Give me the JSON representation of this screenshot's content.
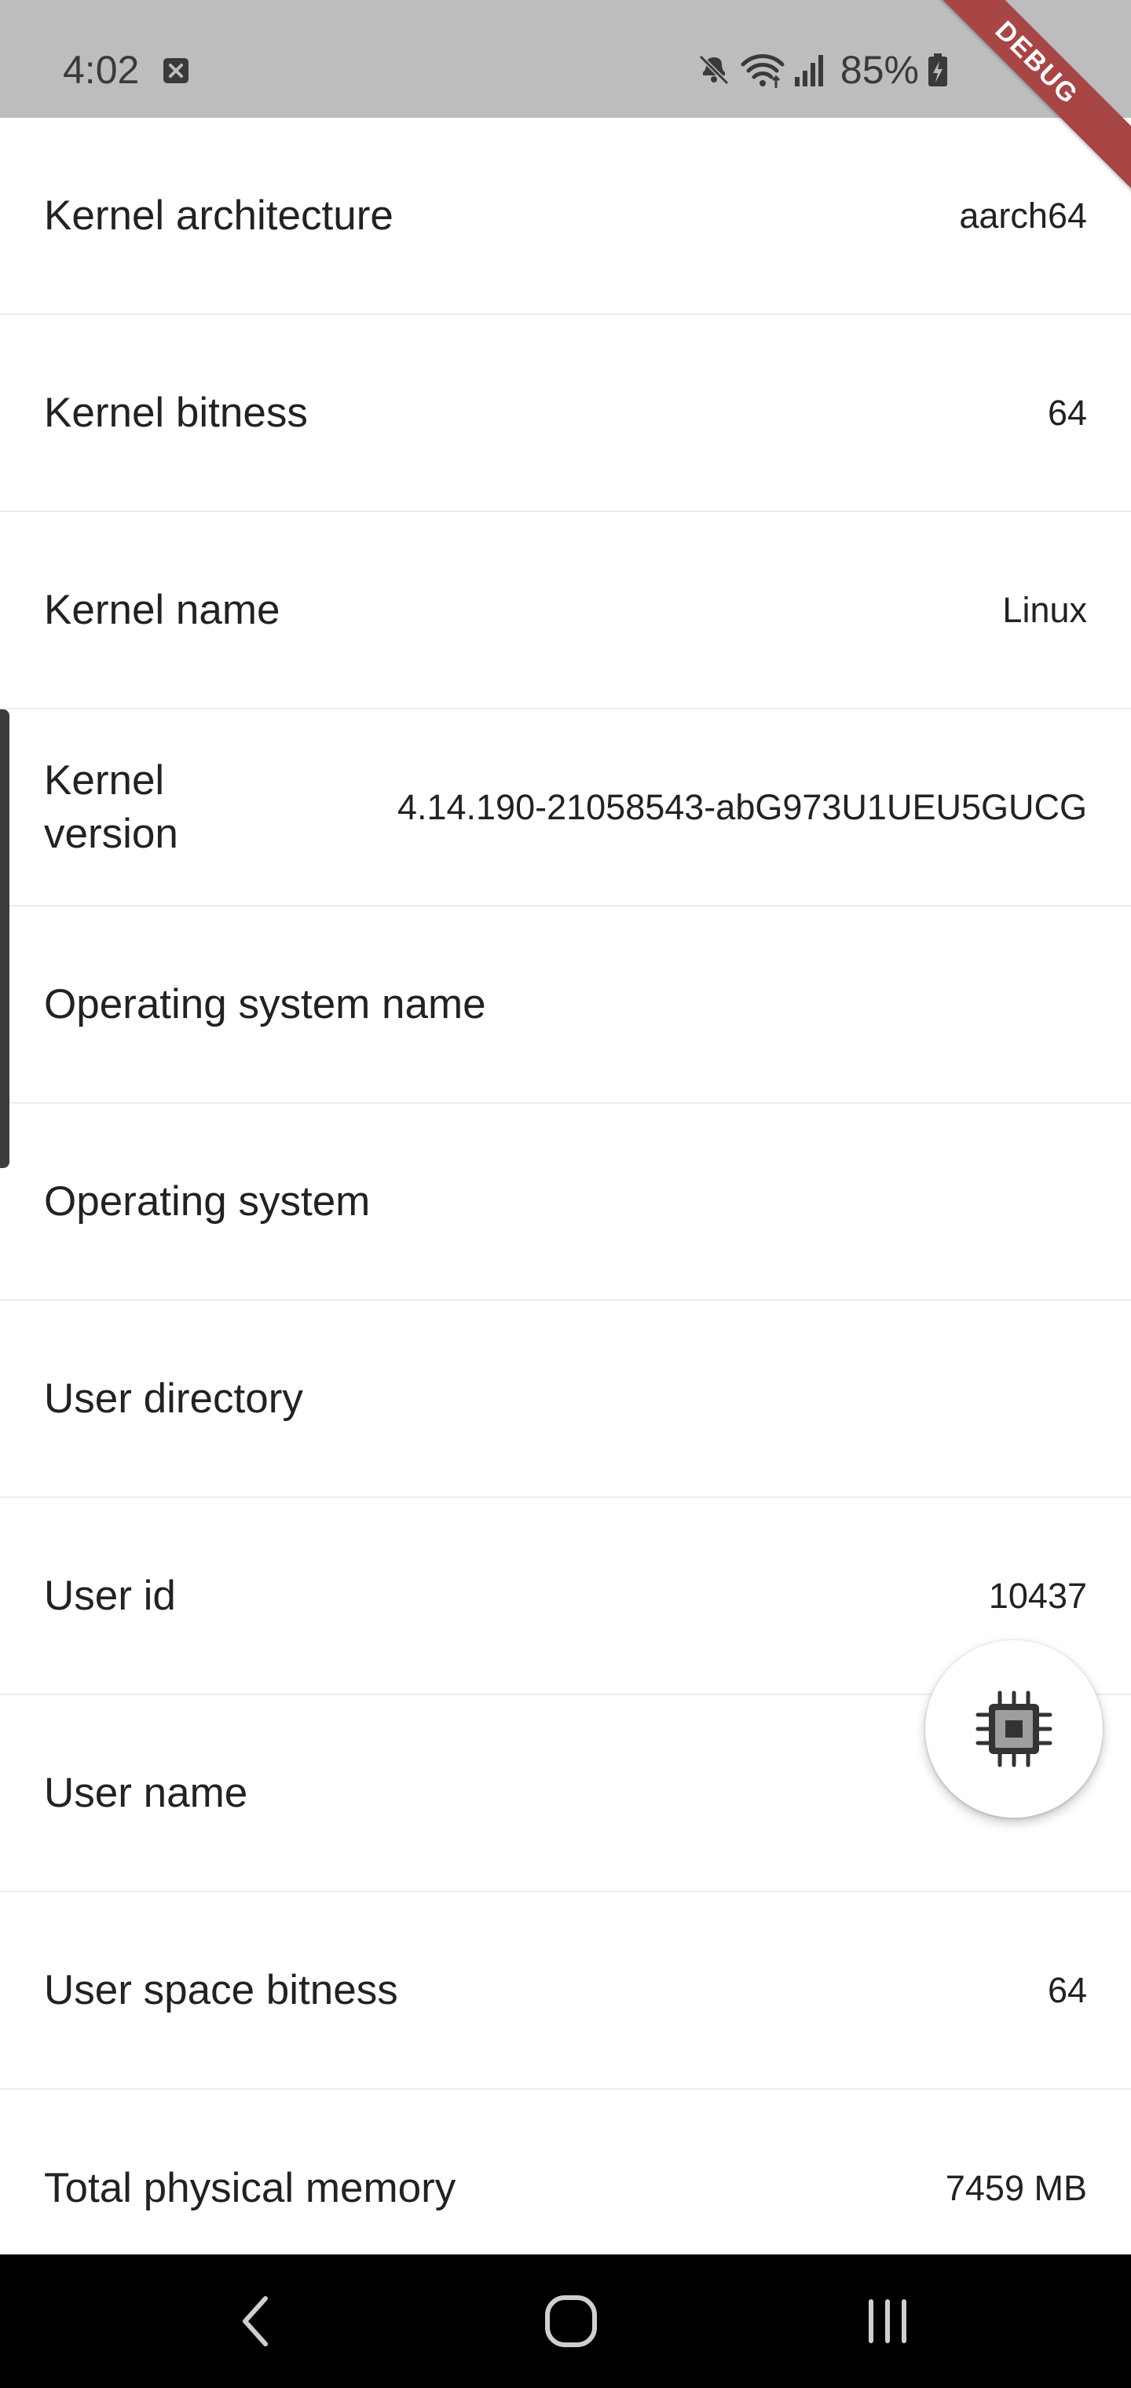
{
  "status_bar": {
    "time": "4:02",
    "battery_percent": "85%",
    "icons": [
      "notification-x-icon",
      "mute-icon",
      "wifi-icon",
      "signal-icon",
      "battery-charging-icon"
    ]
  },
  "debug_banner": "DEBUG",
  "rows": [
    {
      "label": "Kernel architecture",
      "value": "aarch64"
    },
    {
      "label": "Kernel bitness",
      "value": "64"
    },
    {
      "label": "Kernel name",
      "value": "Linux"
    },
    {
      "label": "Kernel version",
      "value": "4.14.190-21058543-abG973U1UEU5GUCG"
    },
    {
      "label": "Operating system name",
      "value": ""
    },
    {
      "label": "Operating system",
      "value": ""
    },
    {
      "label": "User directory",
      "value": ""
    },
    {
      "label": "User id",
      "value": "10437"
    },
    {
      "label": "User name",
      "value": ""
    },
    {
      "label": "User space bitness",
      "value": "64"
    },
    {
      "label": "Total physical memory",
      "value": "7459 MB"
    }
  ],
  "fab": {
    "icon": "cpu-chip-icon"
  },
  "nav_bar": {
    "icons": [
      "back-icon",
      "home-icon",
      "recents-icon"
    ]
  },
  "colors": {
    "status_bar_bg": "#bdbdbd",
    "debug_banner_bg": "#a84646",
    "divider": "#ececec",
    "nav_bar_bg": "#000000"
  }
}
